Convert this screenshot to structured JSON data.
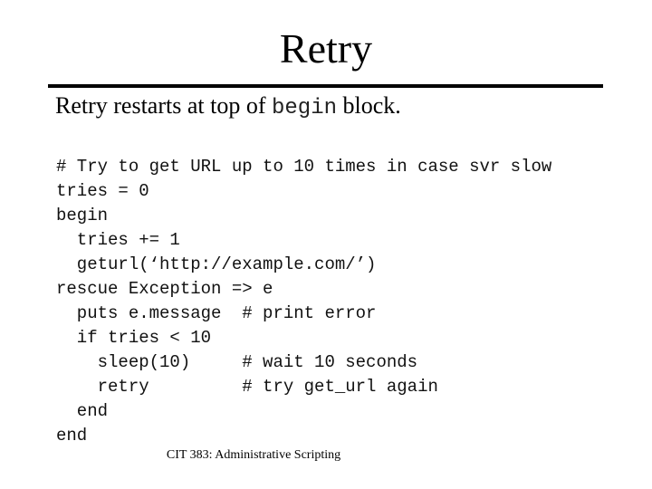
{
  "slide": {
    "title": "Retry",
    "subtitle": {
      "before": "Retry restarts at top of ",
      "code": "begin",
      "after": " block."
    },
    "code_lines": [
      "# Try to get URL up to 10 times in case svr slow",
      "tries = 0",
      "begin",
      "  tries += 1",
      "  geturl(‘http://example.com/’)",
      "rescue Exception => e",
      "  puts e.message  # print error",
      "  if tries < 10",
      "    sleep(10)     # wait 10 seconds",
      "    retry         # try get_url again",
      "  end",
      "end"
    ],
    "footer": "CIT 383: Administrative Scripting"
  }
}
